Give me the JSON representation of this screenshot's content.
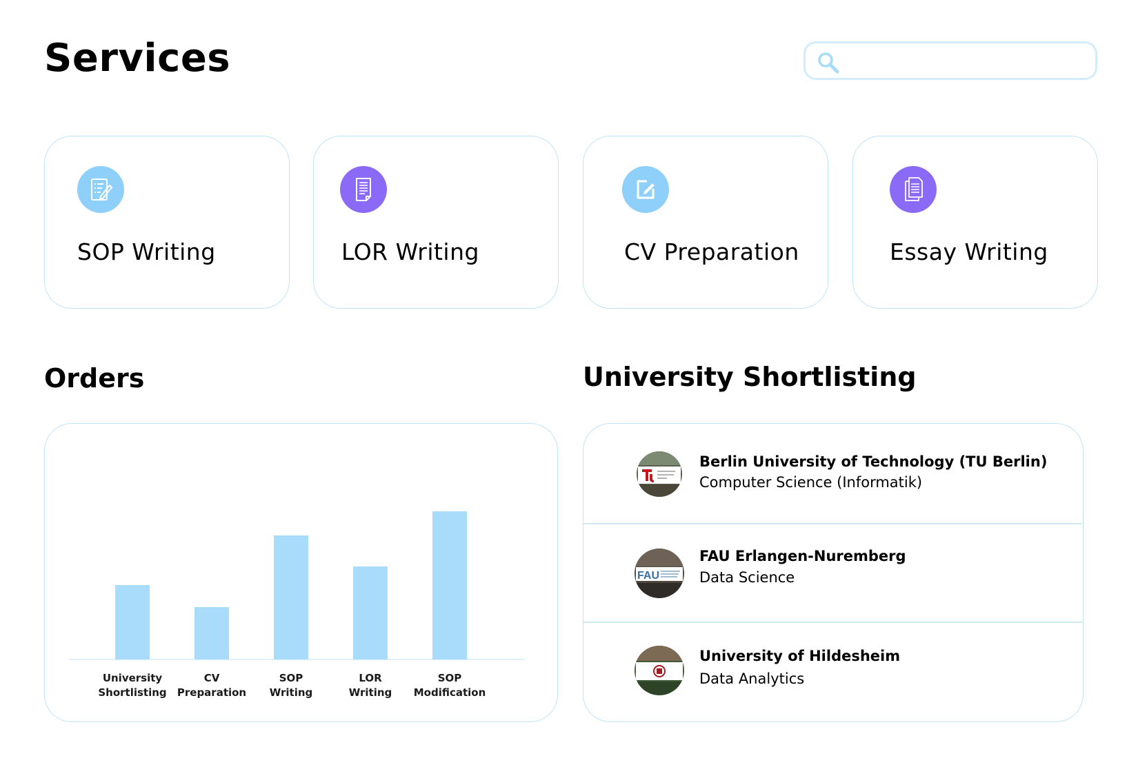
{
  "header": {
    "title": "Services",
    "search": {
      "placeholder": "",
      "value": ""
    }
  },
  "services": [
    {
      "label": "SOP Writing",
      "icon": "sop-checklist-icon",
      "color": "#8fd0fb"
    },
    {
      "label": "LOR Writing",
      "icon": "document-icon",
      "color": "#8b6af7"
    },
    {
      "label": "CV Preparation",
      "icon": "edit-icon",
      "color": "#8fd0fb"
    },
    {
      "label": "Essay Writing",
      "icon": "documents-icon",
      "color": "#8b6af7"
    }
  ],
  "orders": {
    "title": "Orders"
  },
  "chart_data": {
    "type": "bar",
    "categories": [
      [
        "University",
        "Shortlisting"
      ],
      [
        "CV",
        "Preparation"
      ],
      [
        "SOP",
        "Writing"
      ],
      [
        "LOR",
        "Writing"
      ],
      [
        "SOP",
        "Modification"
      ]
    ],
    "values": [
      108,
      76,
      180,
      135,
      215
    ],
    "ylim": [
      0,
      230
    ],
    "bar_color": "#a8dcfa",
    "grid": false
  },
  "shortlisting": {
    "title": "University Shortlisting",
    "items": [
      {
        "name": "Berlin University of Technology (TU Berlin)",
        "program": "Computer Science (Informatik)",
        "logo": "tu-berlin-logo"
      },
      {
        "name": "FAU Erlangen-Nuremberg",
        "program": " Data Science",
        "logo": "fau-logo"
      },
      {
        "name": "University of Hildesheim",
        "program": "Data Analytics",
        "logo": "hildesheim-logo"
      }
    ]
  }
}
